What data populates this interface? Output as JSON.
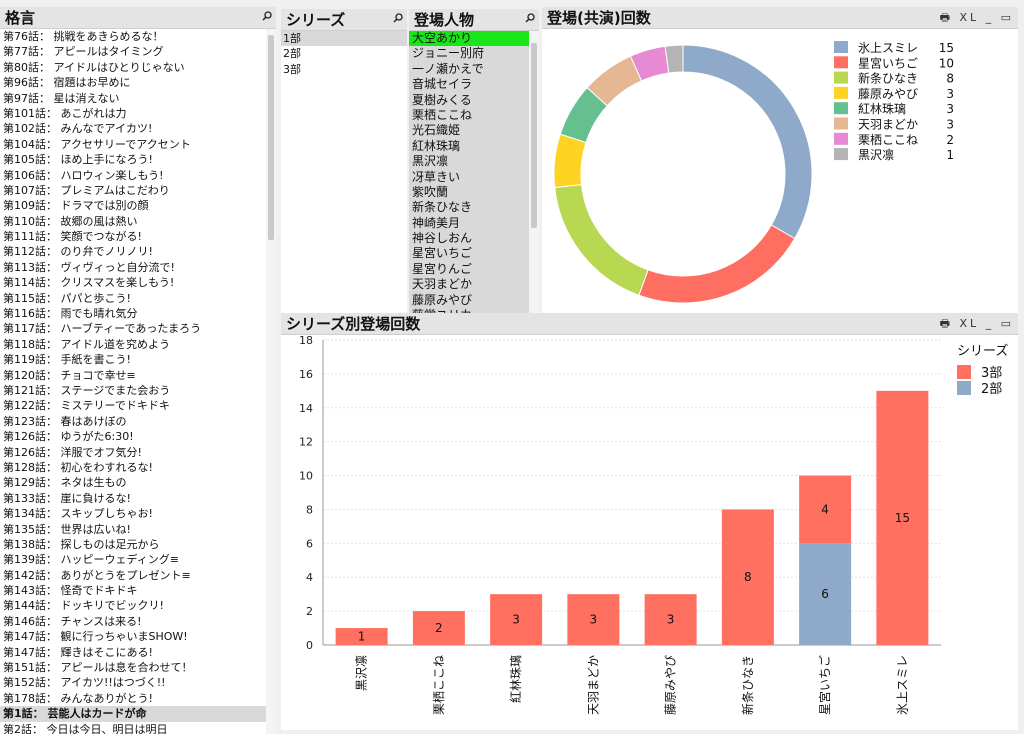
{
  "quotes": {
    "title": "格言",
    "items": [
      "第76話： 挑戦をあきらめるな！",
      "第77話： アピールはタイミング",
      "第80話： アイドルはひとりじゃない",
      "第96話： 宿題はお早めに",
      "第97話： 星は消えない",
      "第101話： あこがれは力",
      "第102話： みんなでアイカツ!",
      "第104話： アクセサリーでアクセント",
      "第105話： ほめ上手になろう!",
      "第106話： ハロウィン楽しもう!",
      "第107話： プレミアムはこだわり",
      "第109話： ドラマでは別の顔",
      "第110話： 故郷の風は熱い",
      "第111話： 笑顔でつながる!",
      "第112話： のり弁でノリノリ!",
      "第113話： ヴィヴィっと自分流で!",
      "第114話： クリスマスを楽しもう!",
      "第115話： パパと歩こう!",
      "第116話： 雨でも晴れ気分",
      "第117話： ハーブティーであったまろう",
      "第118話： アイドル道を究めよう",
      "第119話： 手紙を書こう!",
      "第120話： チョコで幸せ≡",
      "第121話： ステージでまた会おう",
      "第122話： ミステリーでドキドキ",
      "第123話： 春はあけぼの",
      "第126話： ゆうがた6:30!",
      "第126話： 洋服でオフ気分!",
      "第128話： 初心をわすれるな!",
      "第129話： ネタは生もの",
      "第133話： 崖に負けるな!",
      "第134話： スキップしちゃお!",
      "第135話： 世界は広いね!",
      "第138話： 探しものは足元から",
      "第139話： ハッピーウェディング≡",
      "第142話： ありがとうをプレゼント≡",
      "第143話： 怪奇でドキドキ",
      "第144話： ドッキリでビックリ!",
      "第146話： チャンスは来る!",
      "第147話： 観に行っちゃいまSHOW!",
      "第147話： 輝きはそこにある!",
      "第151話： アピールは息を合わせて！",
      "第152話： アイカツ!!はつづく!!",
      "第178話： みんなありがとう!",
      "第1話： 芸能人はカードが命",
      "第2話： 今日は今日、明日は明日"
    ]
  },
  "series_box": {
    "title": "シリーズ",
    "items": [
      "1部",
      "2部",
      "3部"
    ]
  },
  "characters": {
    "title": "登場人物",
    "items": [
      "大空あかり",
      "ジョニー別府",
      "一ノ瀬かえで",
      "音城セイラ",
      "夏樹みくる",
      "栗栖ここね",
      "光石織姫",
      "紅林珠璃",
      "黒沢凛",
      "冴草きい",
      "紫吹蘭",
      "新条ひなき",
      "神崎美月",
      "神谷しおん",
      "星宮いちご",
      "星宮りんご",
      "天羽まどか",
      "藤原みやび",
      "藤堂ユリカ"
    ]
  },
  "donut_panel": {
    "title": "登場(共演)回数",
    "icons": "🖶 XL _ ▭"
  },
  "bar_panel": {
    "title": "シリーズ別登場回数",
    "icons": "🖶 XL _ ▭",
    "legend_title": "シリーズ"
  },
  "colors": {
    "selected_green": "#19e619",
    "series3": "#ff7060",
    "series2": "#8fa9c8"
  },
  "chart_data": [
    {
      "type": "pie",
      "title": "登場(共演)回数",
      "labels": [
        "氷上スミレ",
        "星宮いちご",
        "新条ひなき",
        "藤原みやび",
        "紅林珠璃",
        "天羽まどか",
        "栗栖ここね",
        "黒沢凛"
      ],
      "values": [
        15,
        10,
        8,
        3,
        3,
        3,
        2,
        1
      ],
      "colors": [
        "#8ea9c9",
        "#ff6f61",
        "#b9d851",
        "#ffd324",
        "#64c08f",
        "#e5b792",
        "#e68ad3",
        "#b4b4b4"
      ],
      "legend": "right"
    },
    {
      "type": "bar",
      "title": "シリーズ別登場回数",
      "categories": [
        "黒沢凛",
        "栗栖ここね",
        "紅林珠璃",
        "天羽まどか",
        "藤原みやび",
        "新条ひなき",
        "星宮いちご",
        "氷上スミレ"
      ],
      "series": [
        {
          "name": "2部",
          "values": [
            0,
            0,
            0,
            0,
            0,
            0,
            6,
            0
          ],
          "color": "#8fa9c8"
        },
        {
          "name": "3部",
          "values": [
            1,
            2,
            3,
            3,
            3,
            8,
            4,
            15
          ],
          "color": "#ff7060"
        }
      ],
      "legend_order": [
        "3部",
        "2部"
      ],
      "ylim": [
        0,
        18
      ],
      "yticks": [
        0,
        2,
        4,
        6,
        8,
        10,
        12,
        14,
        16,
        18
      ],
      "stacked": true,
      "legend": "right"
    }
  ]
}
